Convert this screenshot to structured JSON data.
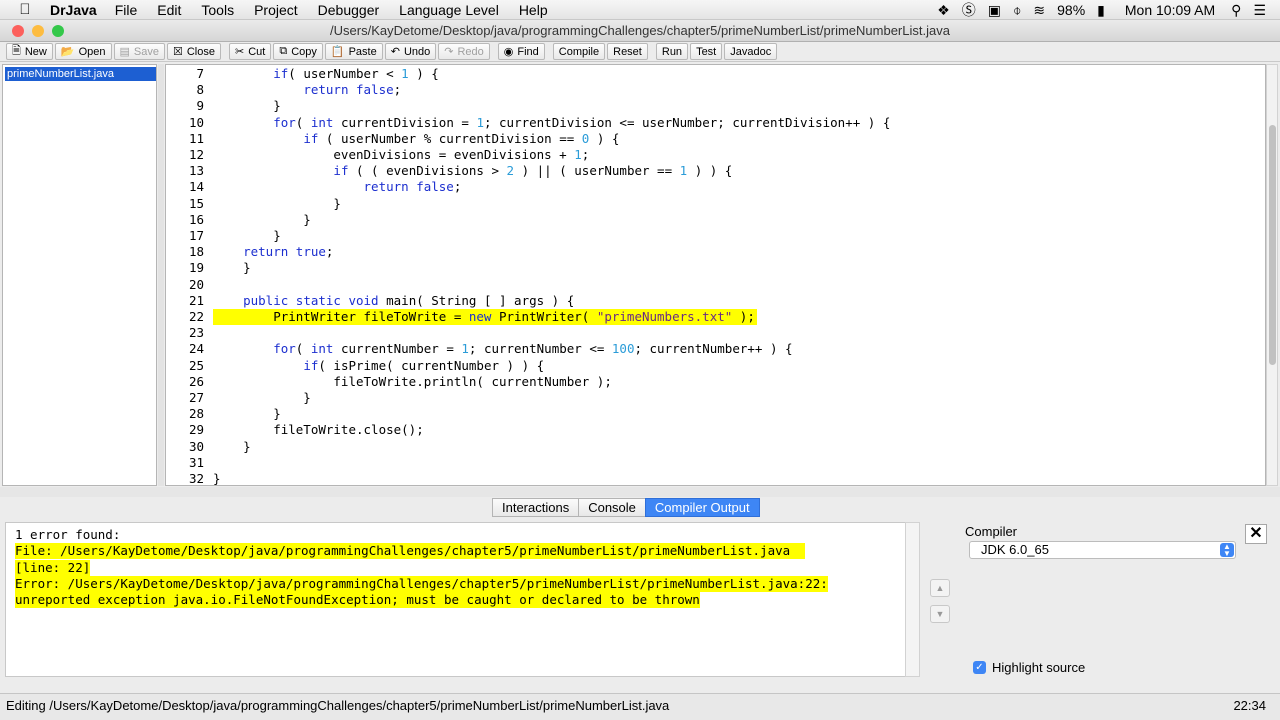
{
  "menubar": {
    "app_name": "DrJava",
    "menus": [
      "File",
      "Edit",
      "Tools",
      "Project",
      "Debugger",
      "Language Level",
      "Help"
    ],
    "battery": "98%",
    "clock": "Mon 10:09 AM"
  },
  "window": {
    "title": "/Users/KayDetome/Desktop/java/programmingChallenges/chapter5/primeNumberList/primeNumberList.java",
    "traffic_colors": [
      "#fc605c",
      "#fdbc40",
      "#34c84a"
    ]
  },
  "toolbar": {
    "new": "New",
    "open": "Open",
    "save": "Save",
    "close": "Close",
    "cut": "Cut",
    "copy": "Copy",
    "paste": "Paste",
    "undo": "Undo",
    "redo": "Redo",
    "find": "Find",
    "compile": "Compile",
    "reset": "Reset",
    "run": "Run",
    "test": "Test",
    "javadoc": "Javadoc"
  },
  "files": [
    "primeNumberList.java"
  ],
  "code": {
    "highlight_color": "#ffff00",
    "lines": [
      {
        "num": "7",
        "text": "        if( userNumber < 1 ) {"
      },
      {
        "num": "8",
        "text": "            return false;"
      },
      {
        "num": "9",
        "text": "        }"
      },
      {
        "num": "10",
        "text": "        for( int currentDivision = 1; currentDivision <= userNumber; currentDivision++ ) {"
      },
      {
        "num": "11",
        "text": "            if ( userNumber % currentDivision == 0 ) {"
      },
      {
        "num": "12",
        "text": "                evenDivisions = evenDivisions + 1;"
      },
      {
        "num": "13",
        "text": "                if ( ( evenDivisions > 2 ) || ( userNumber == 1 ) ) {"
      },
      {
        "num": "14",
        "text": "                    return false;"
      },
      {
        "num": "15",
        "text": "                }"
      },
      {
        "num": "16",
        "text": "            }"
      },
      {
        "num": "17",
        "text": "        }"
      },
      {
        "num": "18",
        "text": "    return true;"
      },
      {
        "num": "19",
        "text": "    }"
      },
      {
        "num": "20",
        "text": ""
      },
      {
        "num": "21",
        "text": "    public static void main( String [ ] args ) {"
      },
      {
        "num": "22",
        "text": "        PrintWriter fileToWrite = new PrintWriter( \"primeNumbers.txt\" );",
        "highlight": true
      },
      {
        "num": "23",
        "text": ""
      },
      {
        "num": "24",
        "text": "        for( int currentNumber = 1; currentNumber <= 100; currentNumber++ ) {"
      },
      {
        "num": "25",
        "text": "            if( isPrime( currentNumber ) ) {"
      },
      {
        "num": "26",
        "text": "                fileToWrite.println( currentNumber );"
      },
      {
        "num": "27",
        "text": "            }"
      },
      {
        "num": "28",
        "text": "        }"
      },
      {
        "num": "29",
        "text": "        fileToWrite.close();"
      },
      {
        "num": "30",
        "text": "    }"
      },
      {
        "num": "31",
        "text": ""
      },
      {
        "num": "32",
        "text": "}"
      }
    ]
  },
  "tabs": [
    "Interactions",
    "Console",
    "Compiler Output"
  ],
  "active_tab": "Compiler Output",
  "output": {
    "lines": [
      {
        "text": "1 error found:",
        "highlight": false
      },
      {
        "text": "File: /Users/KayDetome/Desktop/java/programmingChallenges/chapter5/primeNumberList/primeNumberList.java  ",
        "highlight": true
      },
      {
        "text": "[line: 22]",
        "highlight": true
      },
      {
        "text": "Error: /Users/KayDetome/Desktop/java/programmingChallenges/chapter5/primeNumberList/primeNumberList.java:22:",
        "highlight": true
      },
      {
        "text": "unreported exception java.io.FileNotFoundException; must be caught or declared to be thrown",
        "highlight": true
      }
    ]
  },
  "compiler_panel": {
    "label": "Compiler",
    "selected": "JDK 6.0_65",
    "highlight_source_label": "Highlight source",
    "highlight_source_checked": true
  },
  "status": {
    "editing": "Editing /Users/KayDetome/Desktop/java/programmingChallenges/chapter5/primeNumberList/primeNumberList.java",
    "position": "22:34"
  }
}
